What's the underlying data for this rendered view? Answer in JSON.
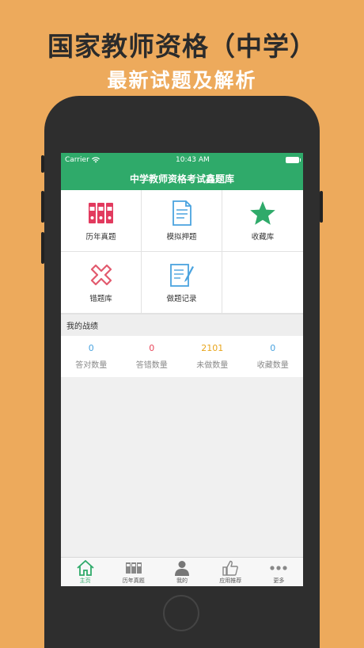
{
  "promo": {
    "title": "国家教师资格（中学）",
    "subtitle": "最新试题及解析"
  },
  "status_bar": {
    "carrier": "Carrier",
    "time": "10:43 AM"
  },
  "nav": {
    "title": "中学教师资格考试鑫题库"
  },
  "menu": [
    {
      "label": "历年真题",
      "icon": "binders-icon"
    },
    {
      "label": "模拟押题",
      "icon": "document-icon"
    },
    {
      "label": "收藏库",
      "icon": "star-icon"
    },
    {
      "label": "错题库",
      "icon": "cross-icon"
    },
    {
      "label": "做题记录",
      "icon": "notepad-icon"
    }
  ],
  "record": {
    "header": "我的战绩",
    "stats": [
      {
        "value": "0",
        "label": "答对数量",
        "color": "#4AA3DF"
      },
      {
        "value": "0",
        "label": "答错数量",
        "color": "#E8465A"
      },
      {
        "value": "2101",
        "label": "未做数量",
        "color": "#E8A51C"
      },
      {
        "value": "0",
        "label": "收藏数量",
        "color": "#4AA3DF"
      }
    ]
  },
  "tabs": [
    {
      "label": "主页",
      "icon": "home-icon",
      "active": true
    },
    {
      "label": "历年真题",
      "icon": "binders-icon",
      "active": false
    },
    {
      "label": "我的",
      "icon": "person-icon",
      "active": false
    },
    {
      "label": "应用推荐",
      "icon": "thumbs-up-icon",
      "active": false
    },
    {
      "label": "更多",
      "icon": "more-icon",
      "active": false
    }
  ],
  "colors": {
    "background": "#EDAA5C",
    "accent": "#2FAA6A"
  }
}
